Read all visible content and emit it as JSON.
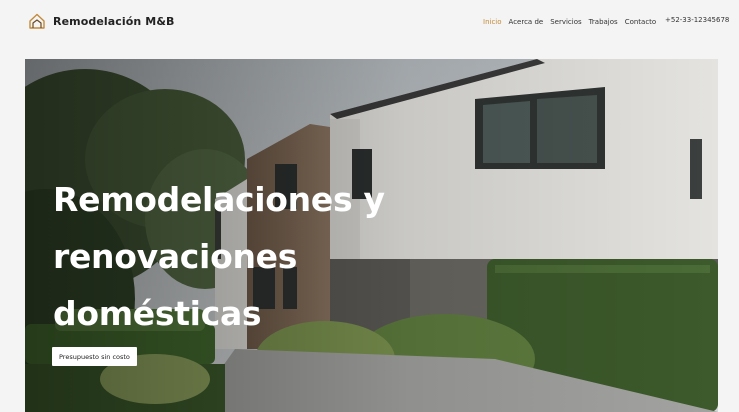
{
  "brand": {
    "name": "Remodelación M&B",
    "icon": "house-outline-icon",
    "accent": "#c38a3a"
  },
  "nav": {
    "items": [
      {
        "label": "Inicio",
        "active": true
      },
      {
        "label": "Acerca de",
        "active": false
      },
      {
        "label": "Servicios",
        "active": false
      },
      {
        "label": "Trabajos",
        "active": false
      },
      {
        "label": "Contacto",
        "active": false
      }
    ],
    "phone": "+52-33-12345678"
  },
  "hero": {
    "title_lines": [
      "Remodelaciones y",
      "renovaciones",
      "domésticas"
    ],
    "cta_label": "Presupuesto sin costo"
  }
}
